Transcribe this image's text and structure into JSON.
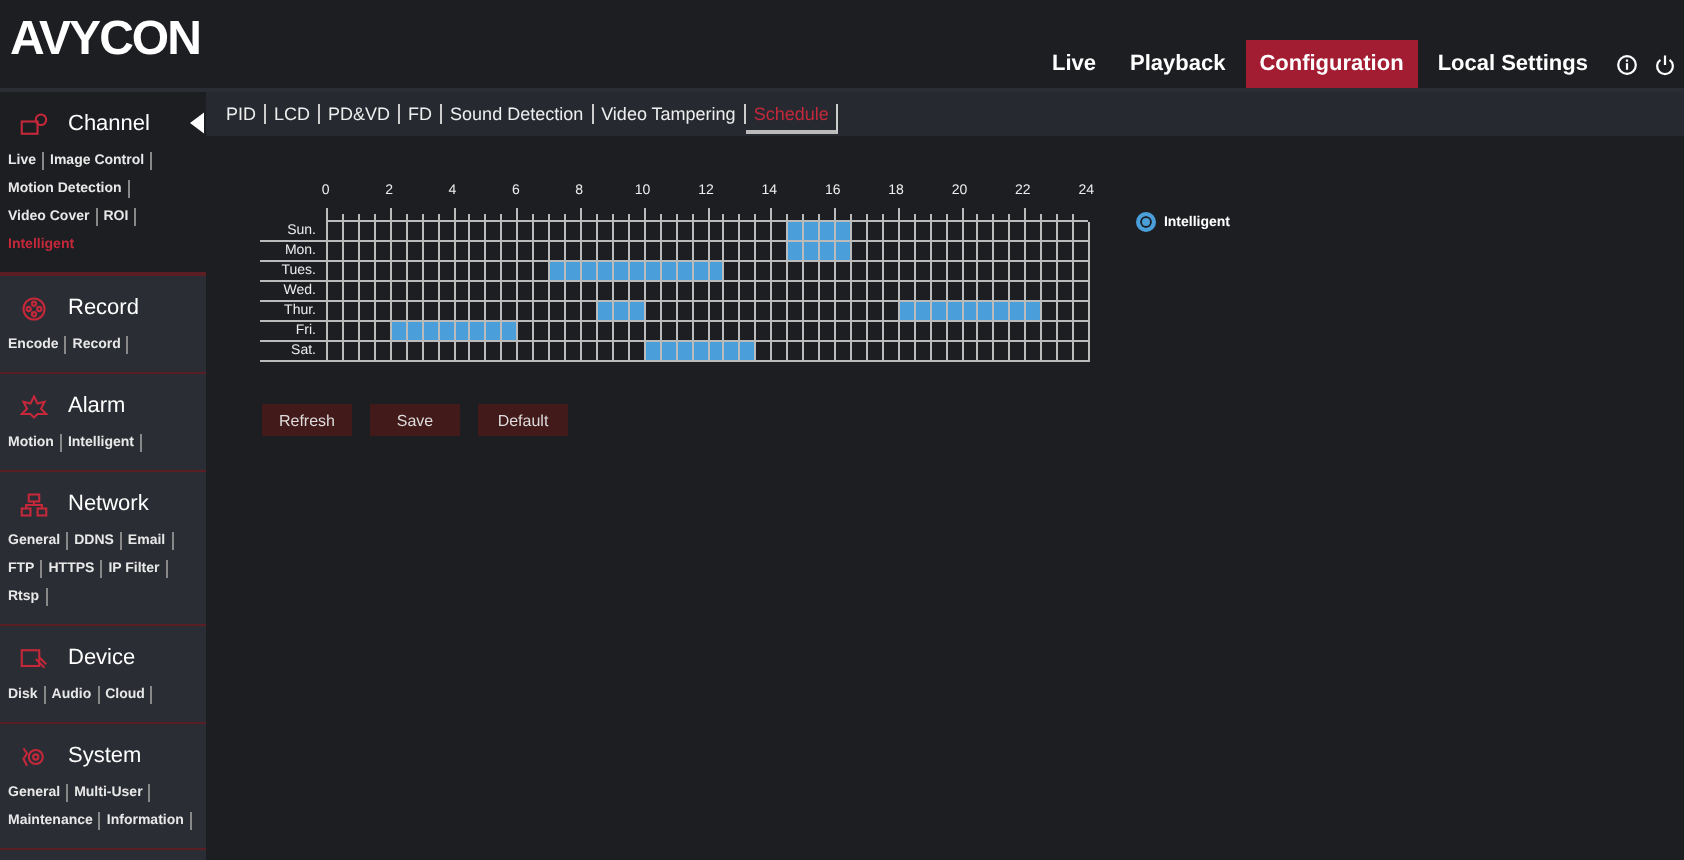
{
  "logo": "AVYCON",
  "nav": [
    {
      "label": "Live",
      "selected": false
    },
    {
      "label": "Playback",
      "selected": false
    },
    {
      "label": "Configuration",
      "selected": true
    },
    {
      "label": "Local Settings",
      "selected": false
    }
  ],
  "sidebar": [
    {
      "title": "Channel",
      "expanded": true,
      "items": [
        {
          "label": "Live",
          "selected": false
        },
        {
          "label": "Image Control",
          "selected": false
        },
        {
          "label": "Motion Detection",
          "selected": false
        },
        {
          "label": "Video Cover",
          "selected": false
        },
        {
          "label": "ROI",
          "selected": false
        },
        {
          "label": "Intelligent",
          "selected": true
        }
      ]
    },
    {
      "title": "Record",
      "expanded": false,
      "items": [
        {
          "label": "Encode",
          "selected": false
        },
        {
          "label": "Record",
          "selected": false
        }
      ]
    },
    {
      "title": "Alarm",
      "expanded": false,
      "items": [
        {
          "label": "Motion",
          "selected": false
        },
        {
          "label": "Intelligent",
          "selected": false
        }
      ]
    },
    {
      "title": "Network",
      "expanded": false,
      "items": [
        {
          "label": "General",
          "selected": false
        },
        {
          "label": "DDNS",
          "selected": false
        },
        {
          "label": "Email",
          "selected": false
        },
        {
          "label": "FTP",
          "selected": false
        },
        {
          "label": "HTTPS",
          "selected": false
        },
        {
          "label": "IP Filter",
          "selected": false
        },
        {
          "label": "Rtsp",
          "selected": false
        }
      ]
    },
    {
      "title": "Device",
      "expanded": false,
      "items": [
        {
          "label": "Disk",
          "selected": false
        },
        {
          "label": "Audio",
          "selected": false
        },
        {
          "label": "Cloud",
          "selected": false
        }
      ]
    },
    {
      "title": "System",
      "expanded": false,
      "items": [
        {
          "label": "General",
          "selected": false
        },
        {
          "label": "Multi-User",
          "selected": false
        },
        {
          "label": "Maintenance",
          "selected": false
        },
        {
          "label": "Information",
          "selected": false
        }
      ]
    }
  ],
  "tabs": [
    {
      "label": "PID",
      "selected": false
    },
    {
      "label": "LCD",
      "selected": false
    },
    {
      "label": "PD&VD",
      "selected": false
    },
    {
      "label": "FD",
      "selected": false
    },
    {
      "label": "Sound Detection",
      "selected": false
    },
    {
      "label": "Video Tampering",
      "selected": false
    },
    {
      "label": "Schedule",
      "selected": true
    }
  ],
  "hours": [
    "0",
    "2",
    "4",
    "6",
    "8",
    "10",
    "12",
    "14",
    "16",
    "18",
    "20",
    "22",
    "24"
  ],
  "legend": {
    "label": "Intelligent",
    "selected": true
  },
  "days": [
    {
      "label": "Sun.",
      "cells": [
        false,
        false,
        false,
        false,
        false,
        false,
        false,
        false,
        false,
        false,
        false,
        false,
        false,
        false,
        false,
        false,
        false,
        false,
        false,
        false,
        false,
        false,
        false,
        false,
        false,
        false,
        false,
        false,
        false,
        true,
        true,
        true,
        true,
        false,
        false,
        false,
        false,
        false,
        false,
        false,
        false,
        false,
        false,
        false,
        false,
        false,
        false,
        false
      ]
    },
    {
      "label": "Mon.",
      "cells": [
        false,
        false,
        false,
        false,
        false,
        false,
        false,
        false,
        false,
        false,
        false,
        false,
        false,
        false,
        false,
        false,
        false,
        false,
        false,
        false,
        false,
        false,
        false,
        false,
        false,
        false,
        false,
        false,
        false,
        true,
        true,
        true,
        true,
        false,
        false,
        false,
        false,
        false,
        false,
        false,
        false,
        false,
        false,
        false,
        false,
        false,
        false,
        false
      ]
    },
    {
      "label": "Tues.",
      "cells": [
        false,
        false,
        false,
        false,
        false,
        false,
        false,
        false,
        false,
        false,
        false,
        false,
        false,
        false,
        true,
        true,
        true,
        true,
        true,
        true,
        true,
        true,
        true,
        true,
        true,
        false,
        false,
        false,
        false,
        false,
        false,
        false,
        false,
        false,
        false,
        false,
        false,
        false,
        false,
        false,
        false,
        false,
        false,
        false,
        false,
        false,
        false,
        false
      ]
    },
    {
      "label": "Wed.",
      "cells": [
        false,
        false,
        false,
        false,
        false,
        false,
        false,
        false,
        false,
        false,
        false,
        false,
        false,
        false,
        false,
        false,
        false,
        false,
        false,
        false,
        false,
        false,
        false,
        false,
        false,
        false,
        false,
        false,
        false,
        false,
        false,
        false,
        false,
        false,
        false,
        false,
        false,
        false,
        false,
        false,
        false,
        false,
        false,
        false,
        false,
        false,
        false,
        false
      ]
    },
    {
      "label": "Thur.",
      "cells": [
        false,
        false,
        false,
        false,
        false,
        false,
        false,
        false,
        false,
        false,
        false,
        false,
        false,
        false,
        false,
        false,
        false,
        true,
        true,
        true,
        false,
        false,
        false,
        false,
        false,
        false,
        false,
        false,
        false,
        false,
        false,
        false,
        false,
        false,
        false,
        false,
        true,
        true,
        true,
        true,
        true,
        true,
        true,
        true,
        true,
        false,
        false,
        false
      ]
    },
    {
      "label": "Fri.",
      "cells": [
        false,
        false,
        false,
        false,
        true,
        true,
        true,
        true,
        true,
        true,
        true,
        true,
        false,
        false,
        false,
        false,
        false,
        false,
        false,
        false,
        false,
        false,
        false,
        false,
        false,
        false,
        false,
        false,
        false,
        false,
        false,
        false,
        false,
        false,
        false,
        false,
        false,
        false,
        false,
        false,
        false,
        false,
        false,
        false,
        false,
        false,
        false,
        false
      ]
    },
    {
      "label": "Sat.",
      "cells": [
        false,
        false,
        false,
        false,
        false,
        false,
        false,
        false,
        false,
        false,
        false,
        false,
        false,
        false,
        false,
        false,
        false,
        false,
        false,
        false,
        true,
        true,
        true,
        true,
        true,
        true,
        true,
        false,
        false,
        false,
        false,
        false,
        false,
        false,
        false,
        false,
        false,
        false,
        false,
        false,
        false,
        false,
        false,
        false,
        false,
        false,
        false,
        false
      ]
    }
  ],
  "buttons": [
    "Refresh",
    "Save",
    "Default"
  ]
}
